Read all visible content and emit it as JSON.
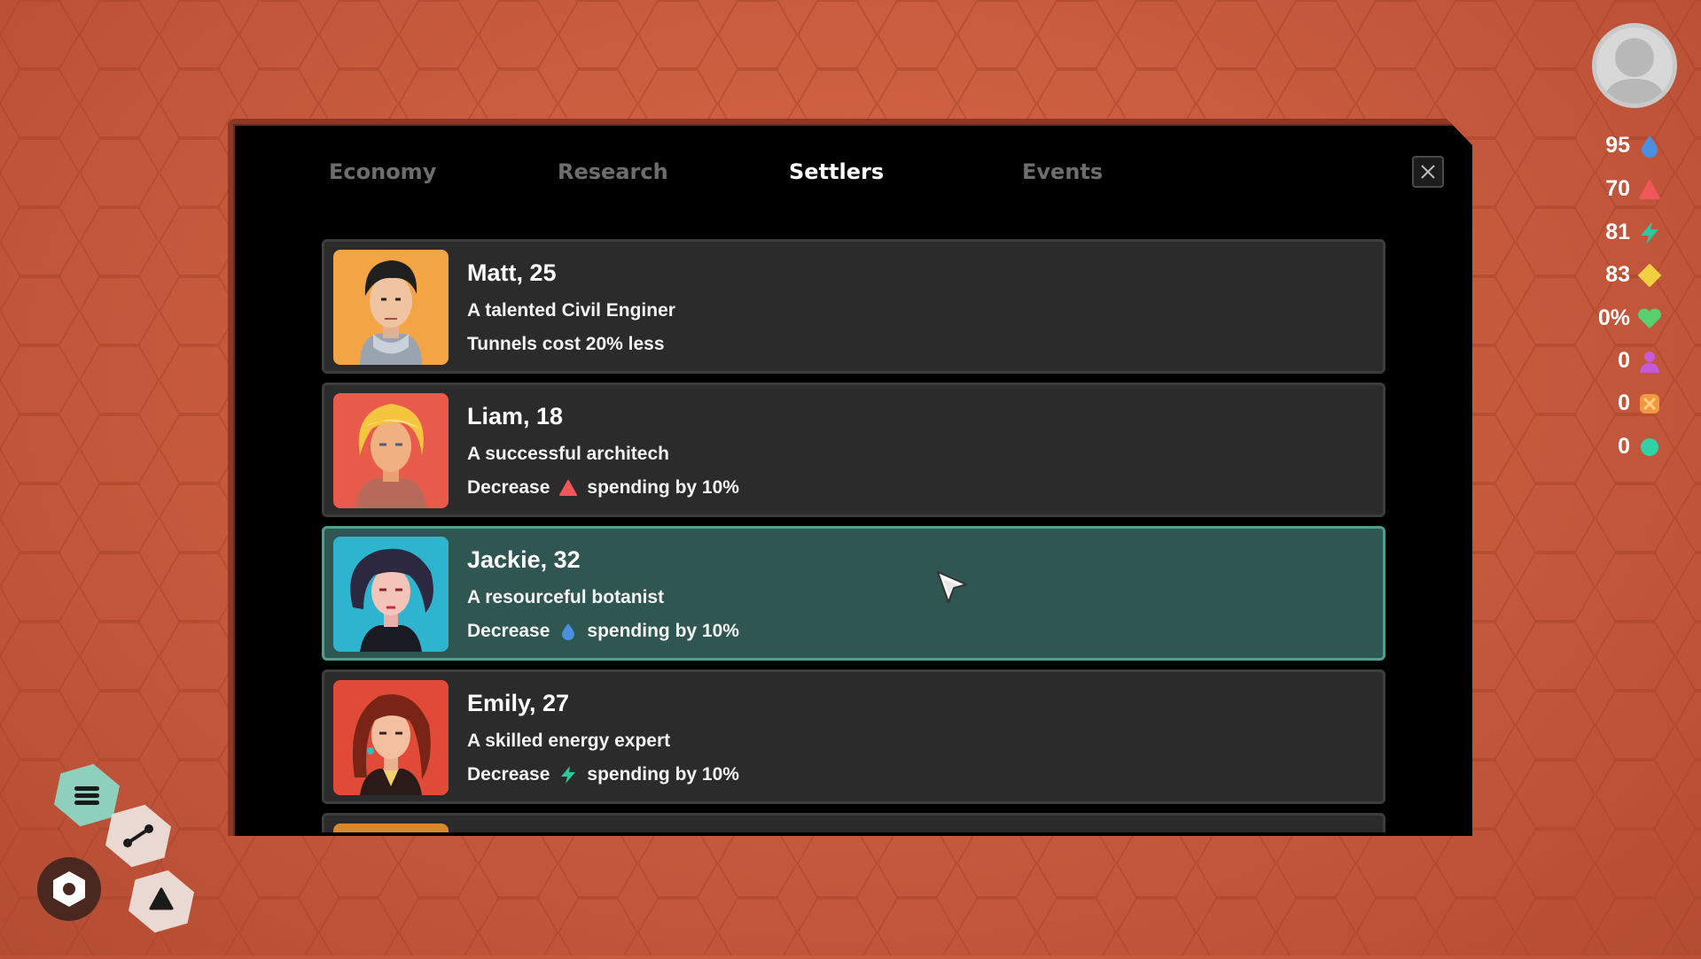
{
  "tabs": [
    {
      "label": "Economy",
      "active": false
    },
    {
      "label": "Research",
      "active": false
    },
    {
      "label": "Settlers",
      "active": true
    },
    {
      "label": "Events",
      "active": false
    }
  ],
  "settlers": [
    {
      "name": "Matt, 25",
      "description": "A talented Civil Enginer",
      "perk": "Tunnels cost 20% less",
      "perk_icon": null,
      "selected": false
    },
    {
      "name": "Liam, 18",
      "description": "A successful architech",
      "perk_prefix": "Decrease",
      "perk_icon": "triangle-icon",
      "perk_suffix": "spending by 10%",
      "selected": false
    },
    {
      "name": "Jackie, 32",
      "description": "A resourceful botanist",
      "perk_prefix": "Decrease",
      "perk_icon": "water-drop-icon",
      "perk_suffix": "spending by 10%",
      "selected": true
    },
    {
      "name": "Emily, 27",
      "description": "A skilled energy expert",
      "perk_prefix": "Decrease",
      "perk_icon": "lightning-icon",
      "perk_suffix": "spending by 10%",
      "selected": false
    }
  ],
  "resources": [
    {
      "value": "95",
      "icon": "water-drop-icon",
      "color": "#4a8fe0"
    },
    {
      "value": "70",
      "icon": "triangle-icon",
      "color": "#f0565a"
    },
    {
      "value": "81",
      "icon": "lightning-icon",
      "color": "#2ec7a0"
    },
    {
      "value": "83",
      "icon": "diamond-icon",
      "color": "#f0d040"
    },
    {
      "value": "0%",
      "icon": "heart-icon",
      "color": "#59d070"
    },
    {
      "value": "0",
      "icon": "person-icon",
      "color": "#c45ad8"
    },
    {
      "value": "0",
      "icon": "star-icon",
      "color": "#f09840"
    },
    {
      "value": "0",
      "icon": "circle-icon",
      "color": "#30d0a8"
    }
  ],
  "colors": {
    "selected_card": "#305651",
    "card": "#2b2b2b",
    "panel": "#000000",
    "background": "#cc5e40"
  }
}
